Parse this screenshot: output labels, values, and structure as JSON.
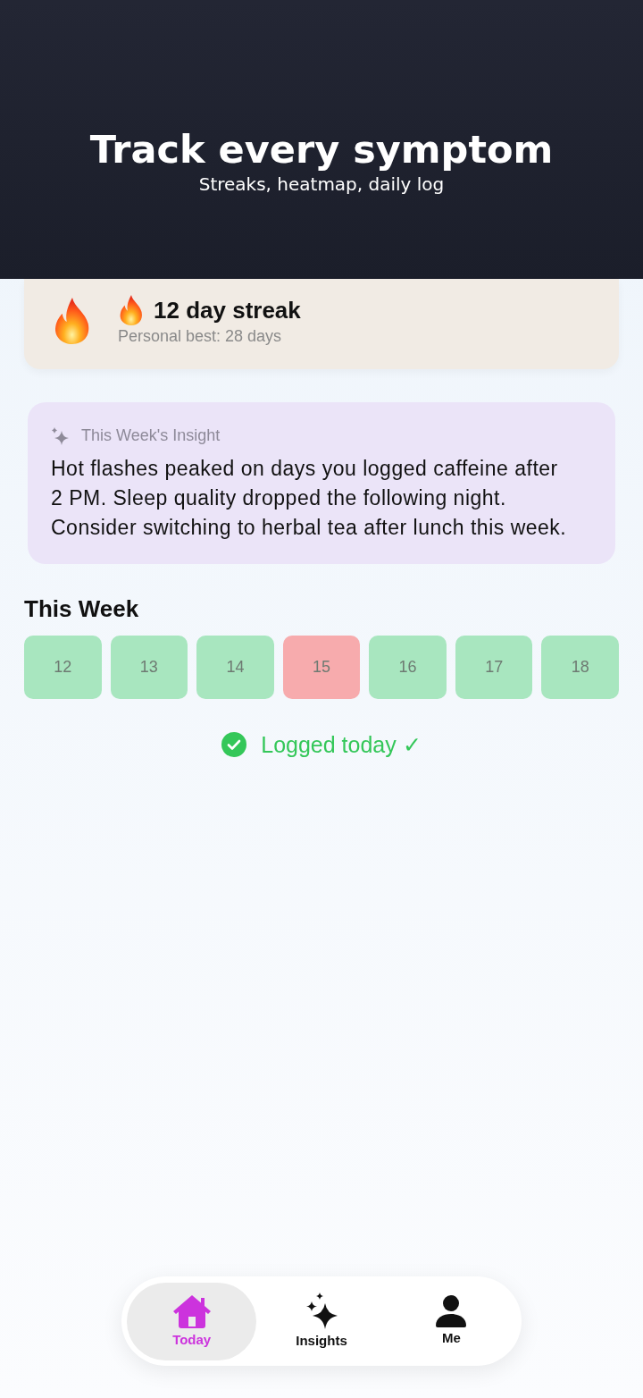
{
  "header": {
    "title": "Track every symptom",
    "subtitle": "Streaks, heatmap, daily log"
  },
  "streak": {
    "title": "12 day streak",
    "subtitle": "Personal best: 28 days"
  },
  "insight": {
    "label": "This Week's Insight",
    "text": "Hot flashes peaked on days you logged caffeine after 2 PM. Sleep quality dropped the following night. Consider switching to herbal tea after lunch this week."
  },
  "week": {
    "title": "This Week",
    "days": [
      {
        "label": "12",
        "color": "#a8e6bf"
      },
      {
        "label": "13",
        "color": "#a8e6bf"
      },
      {
        "label": "14",
        "color": "#a8e6bf"
      },
      {
        "label": "15",
        "color": "#f7abad"
      },
      {
        "label": "16",
        "color": "#a8e6bf"
      },
      {
        "label": "17",
        "color": "#a8e6bf"
      },
      {
        "label": "18",
        "color": "#a8e6bf"
      }
    ]
  },
  "status": {
    "text": "Logged today ✓"
  },
  "nav": {
    "tabs": [
      {
        "label": "Today",
        "selected": true
      },
      {
        "label": "Insights",
        "selected": false
      },
      {
        "label": "Me",
        "selected": false
      }
    ]
  }
}
